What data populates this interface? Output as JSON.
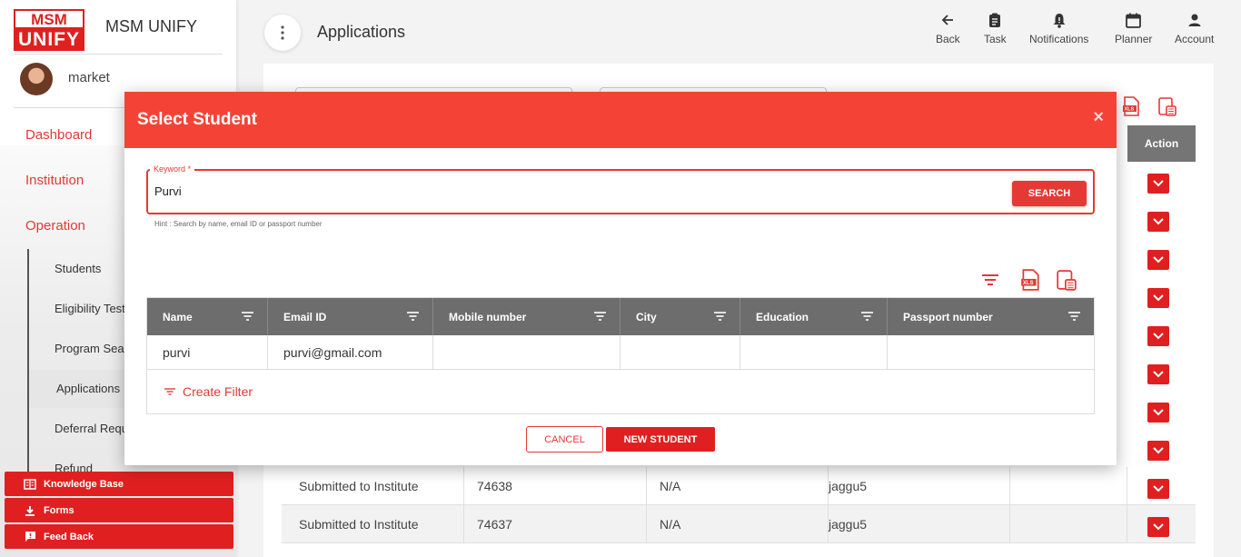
{
  "app": {
    "brand": "MSM UNIFY",
    "logo_top": "MSM",
    "logo_bottom": "UNIFY"
  },
  "user": {
    "name": "market"
  },
  "sidebar": {
    "main": [
      "Dashboard",
      "Institution",
      "Operation"
    ],
    "sub": [
      "Students",
      "Eligibility Test",
      "Program Search",
      "Applications",
      "Deferral Request",
      "Refund"
    ],
    "bottom": [
      "Knowledge Base",
      "Forms",
      "Feed Back"
    ]
  },
  "header": {
    "title": "Applications",
    "actions": [
      {
        "label": "Back",
        "icon": "arrow-left-icon"
      },
      {
        "label": "Task",
        "icon": "clipboard-icon"
      },
      {
        "label": "Notifications",
        "icon": "bell-icon"
      },
      {
        "label": "Planner",
        "icon": "calendar-icon"
      },
      {
        "label": "Account",
        "icon": "person-icon"
      }
    ]
  },
  "background_table": {
    "action_header": "Action",
    "rows": [
      {
        "status": "Submitted to Institute",
        "id": "74638",
        "col3": "N/A",
        "col4": "jaggu5"
      },
      {
        "status": "Submitted to Institute",
        "id": "74637",
        "col3": "N/A",
        "col4": "jaggu5"
      }
    ]
  },
  "modal": {
    "title": "Select Student",
    "close": "×",
    "keyword_label": "Keyword *",
    "keyword_value": "Purvi",
    "search_label": "SEARCH",
    "hint": "Hint : Search by name, email ID or passport number",
    "columns": [
      "Name",
      "Email ID",
      "Mobile number",
      "City",
      "Education",
      "Passport number"
    ],
    "rows": [
      {
        "name": "purvi",
        "email": "purvi@gmail.com",
        "mobile": "",
        "city": "",
        "education": "",
        "passport": ""
      }
    ],
    "create_filter": "Create Filter",
    "cancel_label": "CANCEL",
    "new_label": "NEW STUDENT"
  },
  "colors": {
    "accent": "#e53935",
    "header_red": "#f44336",
    "grid_head": "#6d6d6d"
  }
}
